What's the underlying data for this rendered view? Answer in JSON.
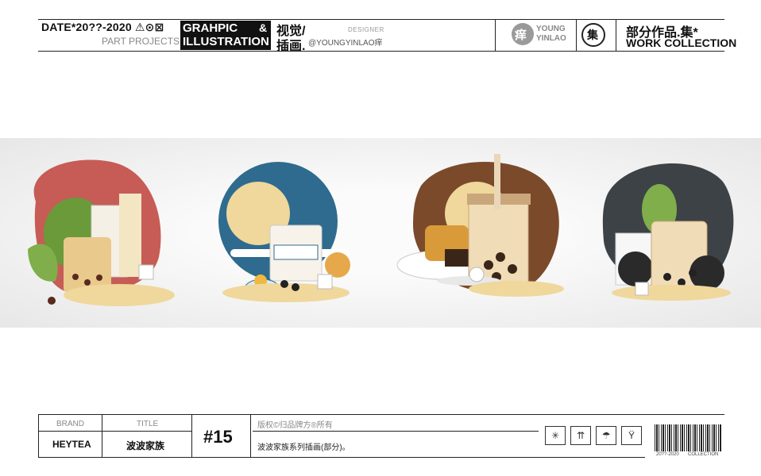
{
  "header": {
    "date": "DATE*20??-2020",
    "date_symbols": "⚠⊙⊠",
    "part_projects": "PART PROJECTS",
    "graphic_line1": "GRAHPIC",
    "graphic_line2": "ILLUSTRATION",
    "ampersand": "&",
    "cn_line1": "视觉/",
    "cn_line2": "插画.",
    "designer_label": "DESIGNER",
    "designer_handle": "@YOUNGYINLAO痒",
    "logo_char": "痒",
    "logo_text": "YOUNG YINLAO",
    "collection_char": "集",
    "work_cn": "部分作品.集*",
    "work_en": "WORK COLLECTION"
  },
  "illustrations": [
    {
      "name": "milk-tea-red"
    },
    {
      "name": "milk-tea-blue"
    },
    {
      "name": "milk-tea-brown"
    },
    {
      "name": "milk-tea-grey"
    }
  ],
  "footer": {
    "brand_label": "BRAND",
    "title_label": "TITLE",
    "brand_value": "HEYTEA",
    "title_value": "波波家族",
    "number": "#15",
    "copyright": "版权©归品牌方®所有",
    "description": "波波家族系列插画(部分)。",
    "barcode_left": "20??-2020",
    "barcode_right": "COLLECTION"
  },
  "colors": {
    "red": "#c65c55",
    "blue": "#2e6b8f",
    "brown": "#7a4a2a",
    "grey": "#3d4247",
    "cream": "#f0d79c"
  }
}
